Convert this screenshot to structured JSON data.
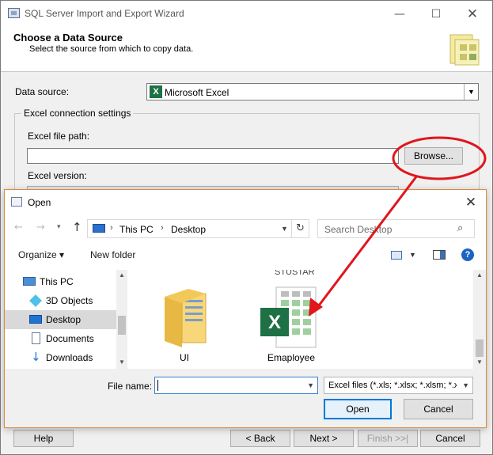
{
  "wizard": {
    "title": "SQL Server Import and Export Wizard",
    "heading": "Choose a Data Source",
    "subheading": "Select the source from which to copy data.",
    "data_source_label": "Data source:",
    "data_source_value": "Microsoft Excel",
    "connection_group_label": "Excel connection settings",
    "file_path_label": "Excel file path:",
    "file_path_value": "",
    "browse_label": "Browse...",
    "version_label": "Excel version:",
    "buttons": {
      "help": "Help",
      "back": "< Back",
      "next": "Next >",
      "finish": "Finish >>|",
      "cancel": "Cancel"
    }
  },
  "open_dialog": {
    "title": "Open",
    "address": {
      "segments": [
        "This PC",
        "Desktop"
      ]
    },
    "search_placeholder": "Search Desktop",
    "toolbar": {
      "organize": "Organize ▾",
      "new_folder": "New folder"
    },
    "nav_items": [
      {
        "label": "This PC",
        "icon": "computer-icon"
      },
      {
        "label": "3D Objects",
        "icon": "3d-objects-icon"
      },
      {
        "label": "Desktop",
        "icon": "desktop-icon",
        "selected": true
      },
      {
        "label": "Documents",
        "icon": "documents-icon"
      },
      {
        "label": "Downloads",
        "icon": "downloads-icon"
      }
    ],
    "partial_top_label": "STUSTAR",
    "files": [
      {
        "name": "UI",
        "type": "folder",
        "icon": "folder-icon"
      },
      {
        "name": "Emaployee",
        "type": "excel",
        "icon": "excel-file-icon"
      }
    ],
    "file_name_label": "File name:",
    "file_name_value": "",
    "file_type_value": "Excel files (*.xls; *.xlsx; *.xlsm; *.x",
    "open_label": "Open",
    "cancel_label": "Cancel"
  },
  "colors": {
    "annotation": "#e0161b",
    "excel_green": "#1e7145",
    "dialog_border": "#d98c3f",
    "open_button_border": "#0078d7"
  }
}
